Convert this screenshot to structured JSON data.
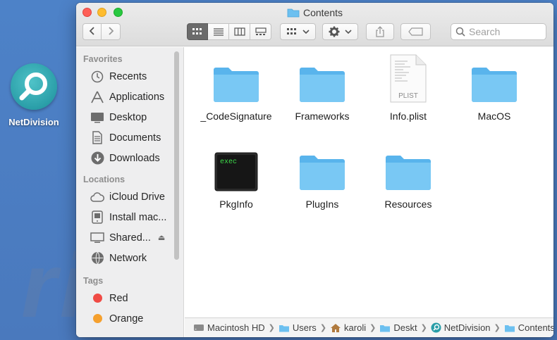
{
  "desktop": {
    "app_label": "NetDivision"
  },
  "window": {
    "title": "Contents",
    "toolbar": {
      "back_icon": "chevron-left-icon",
      "forward_icon": "chevron-right-icon",
      "views": [
        "icon-view",
        "list-view",
        "column-view",
        "gallery-view"
      ],
      "active_view": "icon-view",
      "search_placeholder": "Search"
    },
    "sidebar": {
      "favorites_heading": "Favorites",
      "favorites": [
        {
          "label": "Recents",
          "icon": "clock-icon"
        },
        {
          "label": "Applications",
          "icon": "applications-icon"
        },
        {
          "label": "Desktop",
          "icon": "desktop-icon"
        },
        {
          "label": "Documents",
          "icon": "document-icon"
        },
        {
          "label": "Downloads",
          "icon": "download-icon"
        }
      ],
      "locations_heading": "Locations",
      "locations": [
        {
          "label": "iCloud Drive",
          "icon": "cloud-icon"
        },
        {
          "label": "Install mac...",
          "icon": "disk-icon"
        },
        {
          "label": "Shared...",
          "icon": "display-icon"
        },
        {
          "label": "Network",
          "icon": "globe-icon"
        }
      ],
      "tags_heading": "Tags",
      "tags": [
        {
          "label": "Red",
          "color": "#f04b45"
        },
        {
          "label": "Orange",
          "color": "#f5a02e"
        }
      ]
    },
    "files": [
      {
        "name": "_CodeSignature",
        "kind": "folder"
      },
      {
        "name": "Frameworks",
        "kind": "folder"
      },
      {
        "name": "Info.plist",
        "kind": "plist",
        "badge": "PLIST"
      },
      {
        "name": "MacOS",
        "kind": "folder"
      },
      {
        "name": "PkgInfo",
        "kind": "exec",
        "badge": "exec"
      },
      {
        "name": "PlugIns",
        "kind": "folder"
      },
      {
        "name": "Resources",
        "kind": "folder"
      }
    ],
    "pathbar": [
      {
        "label": "Macintosh HD",
        "icon": "hard-drive-icon"
      },
      {
        "label": "Users",
        "icon": "folder-icon"
      },
      {
        "label": "karoli",
        "icon": "home-icon"
      },
      {
        "label": "Deskt",
        "icon": "folder-icon"
      },
      {
        "label": "NetDivision",
        "icon": "app-icon"
      },
      {
        "label": "Contents",
        "icon": "folder-icon"
      }
    ]
  },
  "colors": {
    "folder_blue": "#6cc0f0",
    "accent": "#3a86d8"
  }
}
